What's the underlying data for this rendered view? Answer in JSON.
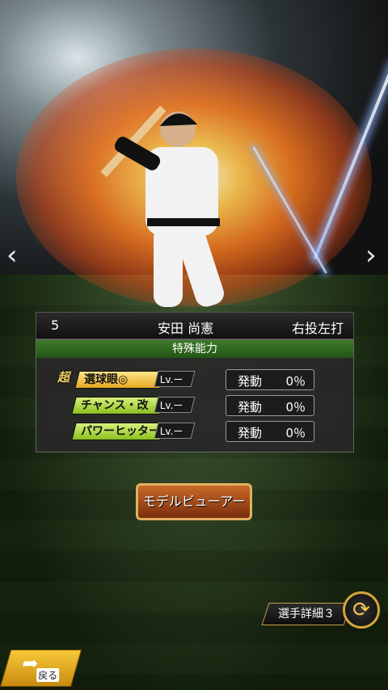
{
  "arrows": {
    "left": "‹",
    "right": "›"
  },
  "player": {
    "number": "5",
    "name": "安田 尚憲",
    "throw_bat": "右投左打"
  },
  "abilities_panel": {
    "title": "特殊能力",
    "super_mark": "超",
    "rows": [
      {
        "name": "選球眼◎",
        "level": "Lv.ー",
        "activate_label": "発動",
        "rate": "0％",
        "color": "#f1c232"
      },
      {
        "name": "チャンス・改",
        "level": "Lv.ー",
        "activate_label": "発動",
        "rate": "0％",
        "color": "#9ccc3c"
      },
      {
        "name": "パワーヒッター",
        "level": "Lv.ー",
        "activate_label": "発動",
        "rate": "0％",
        "color": "#9ccc3c"
      }
    ]
  },
  "model_viewer_button": "モデルビューアー",
  "player_detail": "選手詳細３",
  "back_button": "戻る",
  "colors": {
    "accent_gold": "#d2a63a",
    "panel_green": "#3d7a2a"
  }
}
